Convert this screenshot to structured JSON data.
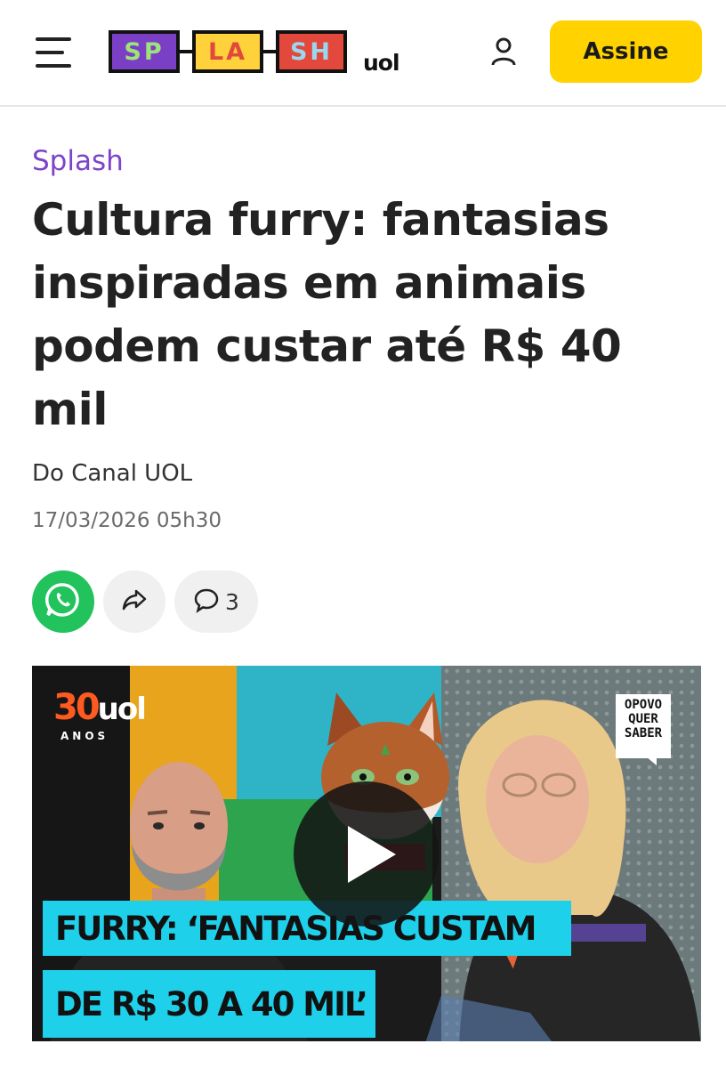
{
  "header": {
    "logo_letters": [
      "SP",
      "LA",
      "SH"
    ],
    "logo_suffix": "uol",
    "subscribe_label": "Assine"
  },
  "article": {
    "section": "Splash",
    "headline": "Cultura furry: fantasias inspiradas em animais podem custar até R$ 40 mil",
    "author": "Do Canal UOL",
    "date": "17/03/2026 05h30",
    "comment_count": "3"
  },
  "video": {
    "brand_number": "30",
    "brand_name": "uol",
    "brand_sub": "ANOS",
    "show_logo_lines": [
      "OPOVO",
      "QUER",
      "SABER"
    ],
    "caption_line1": "FURRY: ‘FANTASIAS CUSTAM",
    "caption_line2": "DE R$ 30 A 40 MIL’"
  },
  "colors": {
    "section": "#7d44c8",
    "subscribe_bg": "#ffd200",
    "whatsapp": "#22c25c",
    "caption_bg": "#1fd0ea"
  },
  "icons": {
    "menu": "hamburger-icon",
    "user": "user-icon",
    "whatsapp": "whatsapp-icon",
    "share": "share-icon",
    "comment": "comment-icon",
    "play": "play-icon"
  }
}
